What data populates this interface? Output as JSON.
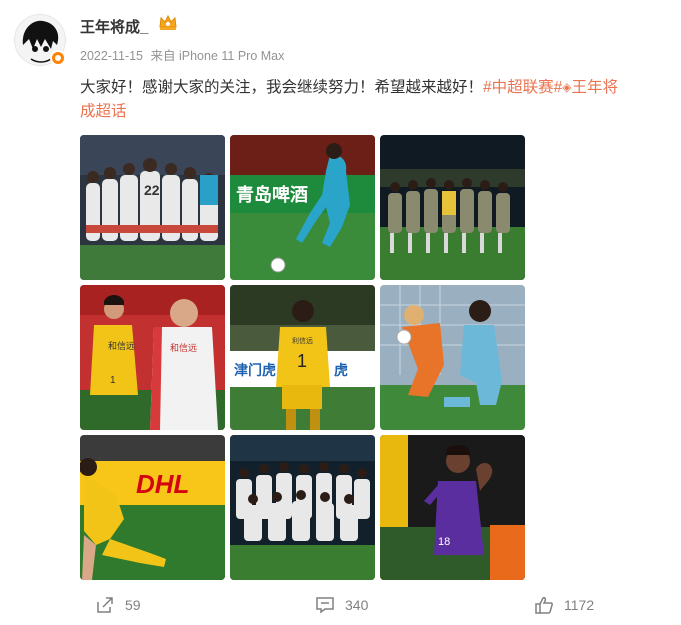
{
  "user": {
    "name": "王年将成_",
    "date": "2022-11-15",
    "source": "来自 iPhone 11 Pro Max"
  },
  "post": {
    "text": "大家好！感谢大家的关注，我会继续努力！希望越来越好！",
    "hashtag": "#中超联赛#",
    "super_topic_line1": "王年将",
    "super_topic_line2": "成超话"
  },
  "images": {
    "img2_banner": "青岛啤酒",
    "img4_sponsor": "和信远",
    "img4_number": "1",
    "img5_board": "津门虎",
    "img5_sponsor": "利信远",
    "img5_number": "1",
    "img9_number": "18",
    "img7_board": "DHL"
  },
  "actions": {
    "share_count": "59",
    "comment_count": "340",
    "like_count": "1172"
  }
}
